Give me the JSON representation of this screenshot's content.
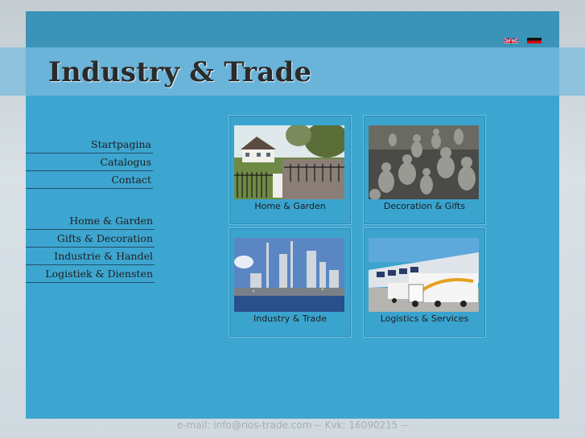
{
  "header": {
    "title": "Industry & Trade",
    "languages": [
      {
        "name": "English",
        "icon": "uk-flag-icon"
      },
      {
        "name": "Deutsch",
        "icon": "german-flag-icon"
      }
    ]
  },
  "nav_primary": [
    {
      "label": "Startpagina"
    },
    {
      "label": "Catalogus"
    },
    {
      "label": "Contact"
    }
  ],
  "nav_secondary": [
    {
      "label": "Home & Garden"
    },
    {
      "label": "Gifts & Decoration"
    },
    {
      "label": "Industrie & Handel"
    },
    {
      "label": "Logistiek & Diensten"
    }
  ],
  "tiles": [
    {
      "caption": "Home & Garden",
      "image": "house-garden-photo"
    },
    {
      "caption": "Decoration & Gifts",
      "image": "buddha-statues-photo"
    },
    {
      "caption": "Industry & Trade",
      "image": "refinery-photo"
    },
    {
      "caption": "Logistics & Services",
      "image": "trucks-warehouse-photo"
    }
  ],
  "footer": {
    "text": "e-mail: info@rios-trade.com -- Kvk: 16090215 --"
  },
  "colors": {
    "frame": "#3da6d0",
    "band": "#6ab3d9",
    "topbar": "#3c93b8"
  }
}
